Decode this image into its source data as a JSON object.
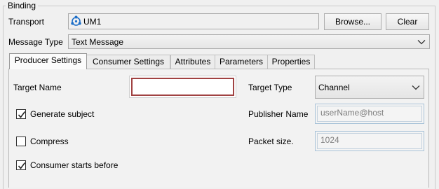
{
  "binding": {
    "title": "Binding",
    "transport": {
      "label": "Transport",
      "value": "UM1",
      "icon": "network-transport-icon",
      "browse_label": "Browse...",
      "clear_label": "Clear"
    },
    "message_type": {
      "label": "Message Type",
      "selected": "Text Message"
    },
    "tabs": [
      {
        "label": "Producer Settings",
        "active": true
      },
      {
        "label": "Consumer Settings",
        "active": false
      },
      {
        "label": "Attributes",
        "active": false
      },
      {
        "label": "Parameters",
        "active": false
      },
      {
        "label": "Properties",
        "active": false
      }
    ],
    "producer": {
      "target_name": {
        "label": "Target Name",
        "value": ""
      },
      "target_type": {
        "label": "Target Type",
        "selected": "Channel"
      },
      "generate_subject": {
        "label": "Generate subject",
        "checked": true
      },
      "publisher_name": {
        "label": "Publisher Name",
        "placeholder": "userName@host"
      },
      "compress": {
        "label": "Compress",
        "checked": false
      },
      "packet_size": {
        "label": "Packet size.",
        "value": "1024"
      },
      "consumer_starts_before": {
        "label": "Consumer starts before",
        "checked": true
      }
    }
  },
  "colors": {
    "window_bg": "#f0f0f0",
    "error_border": "#a04242",
    "readonly_border": "#a8c2d8",
    "icon_blue": "#1e6fc8"
  }
}
